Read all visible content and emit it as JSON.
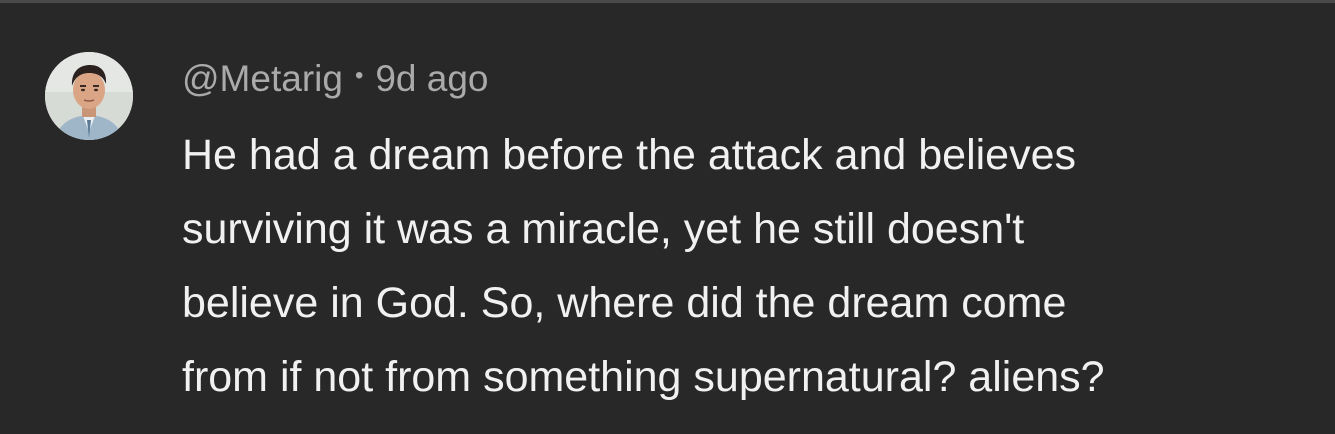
{
  "comment": {
    "author": "@Metarig",
    "separator": "•",
    "timestamp": "9d ago",
    "avatar_icon": "user-avatar-photo",
    "lines": [
      "He had a dream before the attack and believes",
      "surviving it was a miracle, yet he still doesn't",
      "believe in God. So, where did the dream come",
      "from if not from something supernatural? aliens?"
    ]
  },
  "colors": {
    "background": "#282828",
    "meta_text": "#aaaaaa",
    "body_text": "#f1f1f1"
  }
}
